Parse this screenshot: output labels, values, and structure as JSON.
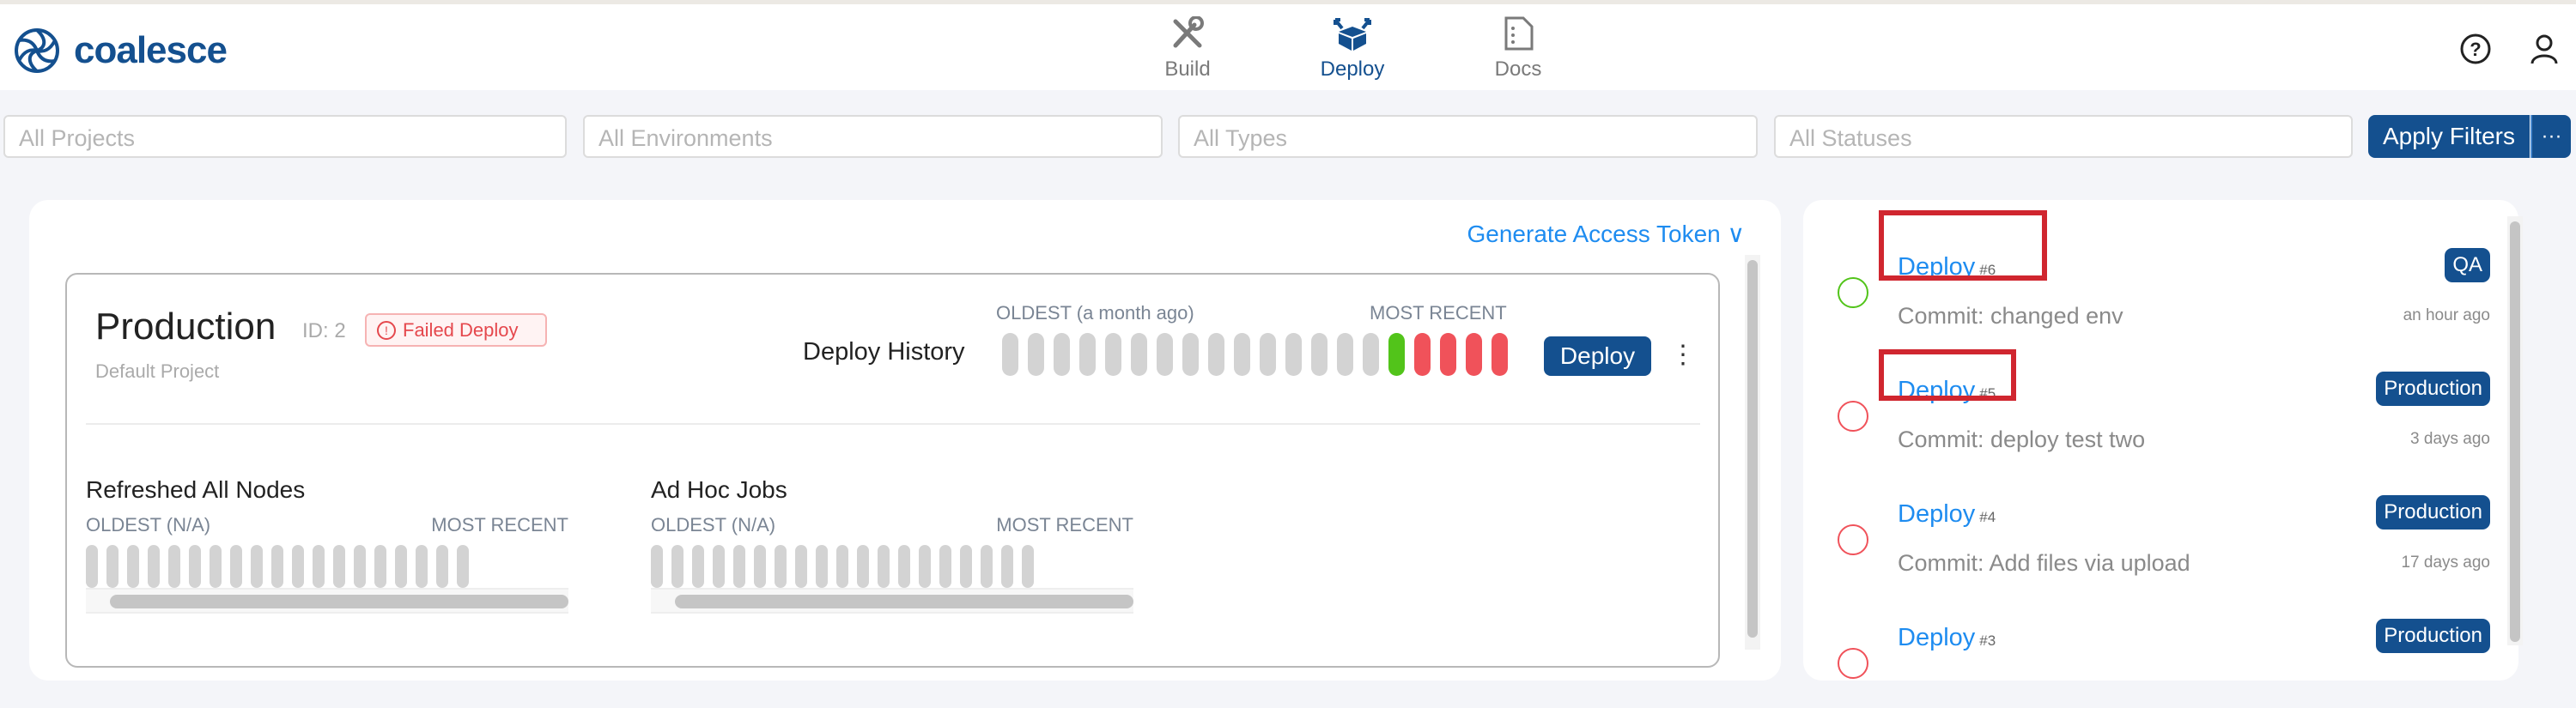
{
  "brand": {
    "name": "coalesce",
    "accent": "#14508f",
    "link": "#1e8cf0"
  },
  "nav": [
    {
      "label": "Build",
      "icon": "tools-icon"
    },
    {
      "label": "Deploy",
      "icon": "deploy-box-icon",
      "active": true
    },
    {
      "label": "Docs",
      "icon": "document-icon"
    }
  ],
  "header_icons": [
    "help-icon",
    "user-icon"
  ],
  "filters": {
    "projects": "All Projects",
    "environments": "All Environments",
    "types": "All Types",
    "statuses": "All Statuses",
    "apply": "Apply Filters",
    "more": "···"
  },
  "main": {
    "generate_token": "Generate Access Token",
    "environment": {
      "name": "Production",
      "id": "ID: 2",
      "status": "Failed Deploy",
      "project": "Default Project",
      "history_label": "Deploy History",
      "oldest": "OLDEST (a month ago)",
      "most_recent": "MOST RECENT",
      "history": [
        "none",
        "none",
        "none",
        "none",
        "none",
        "none",
        "none",
        "none",
        "none",
        "none",
        "none",
        "none",
        "none",
        "none",
        "none",
        "success",
        "failed",
        "failed",
        "failed",
        "failed"
      ],
      "deploy_button": "Deploy",
      "sections": [
        {
          "title": "Refreshed All Nodes",
          "oldest": "OLDEST (N/A)",
          "most_recent": "MOST RECENT",
          "bars": 19
        },
        {
          "title": "Ad Hoc Jobs",
          "oldest": "OLDEST (N/A)",
          "most_recent": "MOST RECENT",
          "bars": 19
        }
      ]
    }
  },
  "colors": {
    "success": "#52c41a",
    "failed": "#f0525a",
    "none": "#d3d3d3"
  },
  "deploys": [
    {
      "label": "Deploy",
      "num": "#6",
      "commit": "Commit: changed env",
      "env": "QA",
      "time": "an hour ago",
      "status": "success",
      "highlighted": true
    },
    {
      "label": "Deploy",
      "num": "#5",
      "commit": "Commit: deploy test two",
      "env": "Production",
      "time": "3 days ago",
      "status": "failed",
      "highlighted": true
    },
    {
      "label": "Deploy",
      "num": "#4",
      "commit": "Commit: Add files via upload",
      "env": "Production",
      "time": "17 days ago",
      "status": "failed"
    },
    {
      "label": "Deploy",
      "num": "#3",
      "commit": "",
      "env": "Production",
      "time": "",
      "status": "failed"
    }
  ]
}
